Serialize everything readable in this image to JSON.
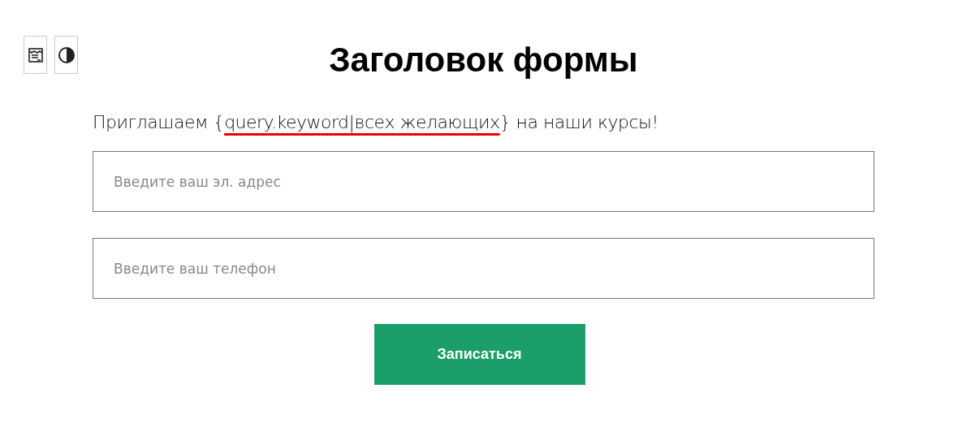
{
  "toolbar": [
    {
      "kind": "layout"
    },
    {
      "kind": "contrast"
    }
  ],
  "form": {
    "title": "Заголовок формы",
    "intro": {
      "before": "Приглашаем {",
      "highlight": "query.keyword|всех желающих",
      "after": "} на наши курсы!"
    },
    "fields": [
      {
        "placeholder": "Введите ваш эл. адрес"
      },
      {
        "placeholder": "Введите ваш телефон"
      }
    ],
    "submit": "Записаться"
  }
}
